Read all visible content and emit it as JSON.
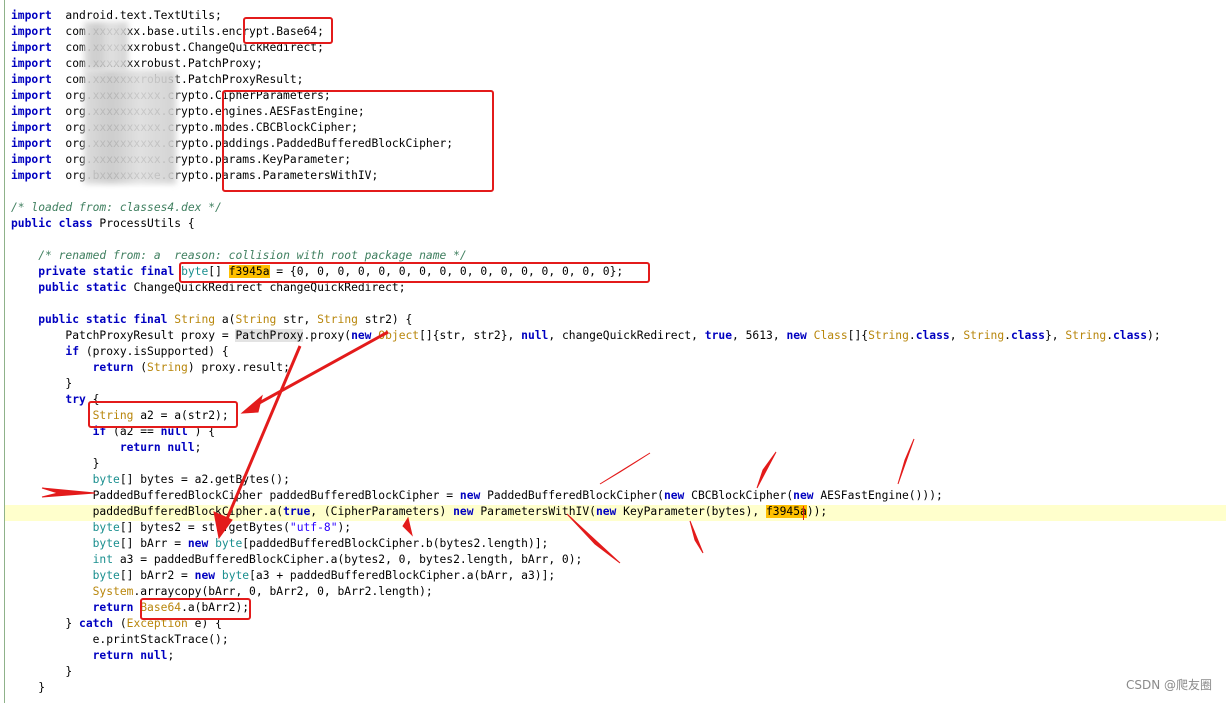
{
  "editor": {
    "lines": [
      {
        "n": 0,
        "segs": [
          [
            "kw",
            "import"
          ],
          [
            "",
            "  android.text.TextUtils;"
          ]
        ]
      },
      {
        "n": 1,
        "segs": [
          [
            "kw",
            "import"
          ],
          [
            "",
            "  com.xxxxxxx.base.utils.encrypt.Base64;"
          ]
        ]
      },
      {
        "n": 2,
        "segs": [
          [
            "kw",
            "import"
          ],
          [
            "",
            "  com.xxxxxxxrobust.ChangeQuickRedirect;"
          ]
        ]
      },
      {
        "n": 3,
        "segs": [
          [
            "kw",
            "import"
          ],
          [
            "",
            "  com.xxxxxxxrobust.PatchProxy;"
          ]
        ]
      },
      {
        "n": 4,
        "segs": [
          [
            "kw",
            "import"
          ],
          [
            "",
            "  com.xxxxxxxrobust.PatchProxyResult;"
          ]
        ]
      },
      {
        "n": 5,
        "segs": [
          [
            "kw",
            "import"
          ],
          [
            "",
            "  org.xxxxxxxxxx.crypto.CipherParameters;"
          ]
        ]
      },
      {
        "n": 6,
        "segs": [
          [
            "kw",
            "import"
          ],
          [
            "",
            "  org.xxxxxxxxxx.crypto.engines.AESFastEngine;"
          ]
        ]
      },
      {
        "n": 7,
        "segs": [
          [
            "kw",
            "import"
          ],
          [
            "",
            "  org.xxxxxxxxxx.crypto.modes.CBCBlockCipher;"
          ]
        ]
      },
      {
        "n": 8,
        "segs": [
          [
            "kw",
            "import"
          ],
          [
            "",
            "  org.xxxxxxxxxx.crypto.paddings.PaddedBufferedBlockCipher;"
          ]
        ]
      },
      {
        "n": 9,
        "segs": [
          [
            "kw",
            "import"
          ],
          [
            "",
            "  org.xxxxxxxxxx.crypto.params.KeyParameter;"
          ]
        ]
      },
      {
        "n": 10,
        "segs": [
          [
            "kw",
            "import"
          ],
          [
            "",
            "  org.bxxxxxxxxe.crypto.params.ParametersWithIV;"
          ]
        ]
      },
      {
        "n": 12,
        "segs": [
          [
            "cm",
            "/* loaded from: classes4.dex */"
          ]
        ]
      },
      {
        "n": 13,
        "segs": [
          [
            "kw",
            "public class"
          ],
          [
            "",
            " ProcessUtils {"
          ]
        ]
      },
      {
        "n": 15,
        "segs": [
          [
            "",
            "    "
          ],
          [
            "cm",
            "/* renamed from: a  reason: collision with root package name */"
          ]
        ]
      },
      {
        "n": 16,
        "segs": [
          [
            "",
            "    "
          ],
          [
            "kw",
            "private static final"
          ],
          [
            "",
            " "
          ],
          [
            "ty2",
            "byte"
          ],
          [
            "",
            "[] "
          ],
          [
            "field-hl",
            "f3945a"
          ],
          [
            "",
            " = {0, 0, 0, 0, 0, 0, 0, 0, 0, 0, 0, 0, 0, 0, 0, 0};"
          ]
        ]
      },
      {
        "n": 17,
        "segs": [
          [
            "",
            "    "
          ],
          [
            "kw",
            "public static"
          ],
          [
            "",
            " ChangeQuickRedirect changeQuickRedirect;"
          ]
        ]
      },
      {
        "n": 19,
        "segs": [
          [
            "",
            "    "
          ],
          [
            "kw",
            "public static final"
          ],
          [
            "",
            " "
          ],
          [
            "ty",
            "String"
          ],
          [
            "",
            " a("
          ],
          [
            "ty",
            "String"
          ],
          [
            "",
            " str, "
          ],
          [
            "ty",
            "String"
          ],
          [
            "",
            " str2) {"
          ]
        ]
      },
      {
        "n": 20,
        "segs": [
          [
            "",
            "        PatchProxyResult proxy = "
          ],
          [
            "ref-hl",
            "PatchProxy"
          ],
          [
            "",
            ".proxy("
          ],
          [
            "kw",
            "new"
          ],
          [
            "",
            " "
          ],
          [
            "ty",
            "Object"
          ],
          [
            "",
            "[]{str, str2}, "
          ],
          [
            "kw",
            "null"
          ],
          [
            "",
            ", changeQuickRedirect, "
          ],
          [
            "kw",
            "true"
          ],
          [
            "",
            ", 5613, "
          ],
          [
            "kw",
            "new"
          ],
          [
            "",
            " "
          ],
          [
            "ty",
            "Class"
          ],
          [
            "",
            "[]{"
          ],
          [
            "ty",
            "String"
          ],
          [
            "",
            "."
          ],
          [
            "kw",
            "class"
          ],
          [
            "",
            ", "
          ],
          [
            "ty",
            "String"
          ],
          [
            "",
            "."
          ],
          [
            "kw",
            "class"
          ],
          [
            "",
            "}, "
          ],
          [
            "ty",
            "String"
          ],
          [
            "",
            "."
          ],
          [
            "kw",
            "class"
          ],
          [
            "",
            ");"
          ]
        ]
      },
      {
        "n": 21,
        "segs": [
          [
            "",
            "        "
          ],
          [
            "kw",
            "if"
          ],
          [
            "",
            " (proxy.isSupported) {"
          ]
        ]
      },
      {
        "n": 22,
        "segs": [
          [
            "",
            "            "
          ],
          [
            "kw",
            "return"
          ],
          [
            "",
            " ("
          ],
          [
            "ty",
            "String"
          ],
          [
            "",
            ") proxy.result;"
          ]
        ]
      },
      {
        "n": 23,
        "segs": [
          [
            "",
            "        }"
          ]
        ]
      },
      {
        "n": 24,
        "segs": [
          [
            "",
            "        "
          ],
          [
            "kw",
            "try"
          ],
          [
            "",
            " {"
          ]
        ]
      },
      {
        "n": 25,
        "segs": [
          [
            "",
            "            "
          ],
          [
            "ty",
            "String"
          ],
          [
            "",
            " a2 = a(str2);"
          ]
        ]
      },
      {
        "n": 26,
        "segs": [
          [
            "",
            "            "
          ],
          [
            "kw",
            "if"
          ],
          [
            "",
            " (a2 == "
          ],
          [
            "kw",
            "null"
          ],
          [
            "",
            " ) {"
          ]
        ]
      },
      {
        "n": 27,
        "segs": [
          [
            "",
            "                "
          ],
          [
            "kw",
            "return null"
          ],
          [
            "",
            ";"
          ]
        ]
      },
      {
        "n": 28,
        "segs": [
          [
            "",
            "            }"
          ]
        ]
      },
      {
        "n": 29,
        "segs": [
          [
            "",
            "            "
          ],
          [
            "ty2",
            "byte"
          ],
          [
            "",
            "[] bytes = a2.getBytes();"
          ]
        ]
      },
      {
        "n": 30,
        "segs": [
          [
            "",
            "            PaddedBufferedBlockCipher paddedBufferedBlockCipher = "
          ],
          [
            "kw",
            "new"
          ],
          [
            "",
            " PaddedBufferedBlockCipher("
          ],
          [
            "kw",
            "new"
          ],
          [
            "",
            " CBCBlockCipher("
          ],
          [
            "kw",
            "new"
          ],
          [
            "",
            " AESFastEngine()));"
          ]
        ]
      },
      {
        "n": 31,
        "segs": [
          [
            "",
            "            paddedBufferedBlockCipher.a("
          ],
          [
            "kw",
            "true"
          ],
          [
            "",
            ", (CipherParameters) "
          ],
          [
            "kw",
            "new"
          ],
          [
            "",
            " ParametersWithIV("
          ],
          [
            "kw",
            "new"
          ],
          [
            "",
            " KeyParameter(bytes), "
          ],
          [
            "field-hl",
            "f3945a"
          ],
          [
            "",
            "));"
          ]
        ]
      },
      {
        "n": 32,
        "segs": [
          [
            "",
            "            "
          ],
          [
            "ty2",
            "byte"
          ],
          [
            "",
            "[] bytes2 = str.getBytes("
          ],
          [
            "st",
            "\"utf-8\""
          ],
          [
            "",
            ");"
          ]
        ]
      },
      {
        "n": 33,
        "segs": [
          [
            "",
            "            "
          ],
          [
            "ty2",
            "byte"
          ],
          [
            "",
            "[] bArr = "
          ],
          [
            "kw",
            "new"
          ],
          [
            "",
            " "
          ],
          [
            "ty2",
            "byte"
          ],
          [
            "",
            "[paddedBufferedBlockCipher.b(bytes2.length)];"
          ]
        ]
      },
      {
        "n": 34,
        "segs": [
          [
            "",
            "            "
          ],
          [
            "ty2",
            "int"
          ],
          [
            "",
            " a3 = paddedBufferedBlockCipher.a(bytes2, 0, bytes2.length, bArr, 0);"
          ]
        ]
      },
      {
        "n": 35,
        "segs": [
          [
            "",
            "            "
          ],
          [
            "ty2",
            "byte"
          ],
          [
            "",
            "[] bArr2 = "
          ],
          [
            "kw",
            "new"
          ],
          [
            "",
            " "
          ],
          [
            "ty2",
            "byte"
          ],
          [
            "",
            "[a3 + paddedBufferedBlockCipher.a(bArr, a3)];"
          ]
        ]
      },
      {
        "n": 36,
        "segs": [
          [
            "",
            "            "
          ],
          [
            "ty",
            "System"
          ],
          [
            "",
            ".arraycopy(bArr, 0, bArr2, 0, bArr2.length);"
          ]
        ]
      },
      {
        "n": 37,
        "segs": [
          [
            "",
            "            "
          ],
          [
            "kw",
            "return"
          ],
          [
            "",
            " "
          ],
          [
            "ty",
            "Base64"
          ],
          [
            "",
            ".a(bArr2);"
          ]
        ]
      },
      {
        "n": 38,
        "segs": [
          [
            "",
            "        } "
          ],
          [
            "kw",
            "catch"
          ],
          [
            "",
            " ("
          ],
          [
            "ty",
            "Exception"
          ],
          [
            "",
            " e) {"
          ]
        ]
      },
      {
        "n": 39,
        "segs": [
          [
            "",
            "            e.printStackTrace();"
          ]
        ]
      },
      {
        "n": 40,
        "segs": [
          [
            "",
            "            "
          ],
          [
            "kw",
            "return null"
          ],
          [
            "",
            ";"
          ]
        ]
      },
      {
        "n": 41,
        "segs": [
          [
            "",
            "        }"
          ]
        ]
      },
      {
        "n": 42,
        "segs": [
          [
            "",
            "    }"
          ]
        ]
      }
    ],
    "highlighted_line": 31
  },
  "watermark": "CSDN @爬友圈",
  "colors": {
    "annotation_red": "#e31b1b",
    "keyword_blue": "#0000c0",
    "type_gold": "#b8860b",
    "comment_green": "#3f7f5f",
    "field_highlight": "#ffc000",
    "current_line": "#ffffcc"
  }
}
